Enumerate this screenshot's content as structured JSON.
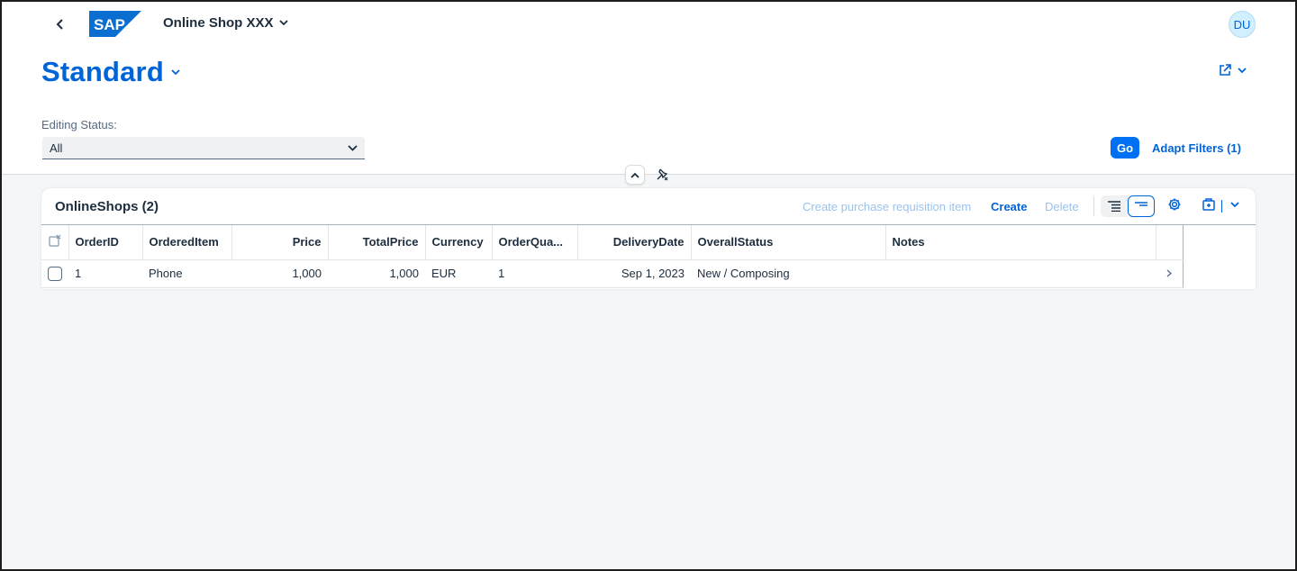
{
  "shell": {
    "brand": "SAP",
    "app_title": "Online Shop XXX",
    "avatar_initials": "DU"
  },
  "header": {
    "variant_title": "Standard"
  },
  "filters": {
    "editing_status_label": "Editing Status:",
    "editing_status_value": "All",
    "go_label": "Go",
    "adapt_filters_label": "Adapt Filters (1)"
  },
  "table": {
    "title": "OnlineShops (2)",
    "actions": {
      "create_pr_item": "Create purchase requisition item",
      "create": "Create",
      "delete": "Delete"
    },
    "columns": [
      "OrderID",
      "OrderedItem",
      "Price",
      "TotalPrice",
      "Currency",
      "OrderQua...",
      "DeliveryDate",
      "OverallStatus",
      "Notes"
    ],
    "rows": [
      {
        "order_id": "1",
        "ordered_item": "Phone",
        "price": "1,000",
        "total_price": "1,000",
        "currency": "EUR",
        "order_quantity": "1",
        "delivery_date": "Sep 1, 2023",
        "overall_status": "New / Composing",
        "notes": ""
      }
    ]
  },
  "colors": {
    "accent": "#0064d9",
    "button_emphasized": "#0070f2",
    "text": "#1d2d3e",
    "background": "#f5f6f7"
  },
  "icons": [
    "back-icon",
    "sap-logo",
    "chevron-down-icon",
    "share-icon",
    "collapse-up-icon",
    "pin-icon",
    "condensed-view-icon",
    "compact-view-icon",
    "settings-gear-icon",
    "export-icon",
    "chevron-right-icon",
    "clear-selection-icon"
  ]
}
